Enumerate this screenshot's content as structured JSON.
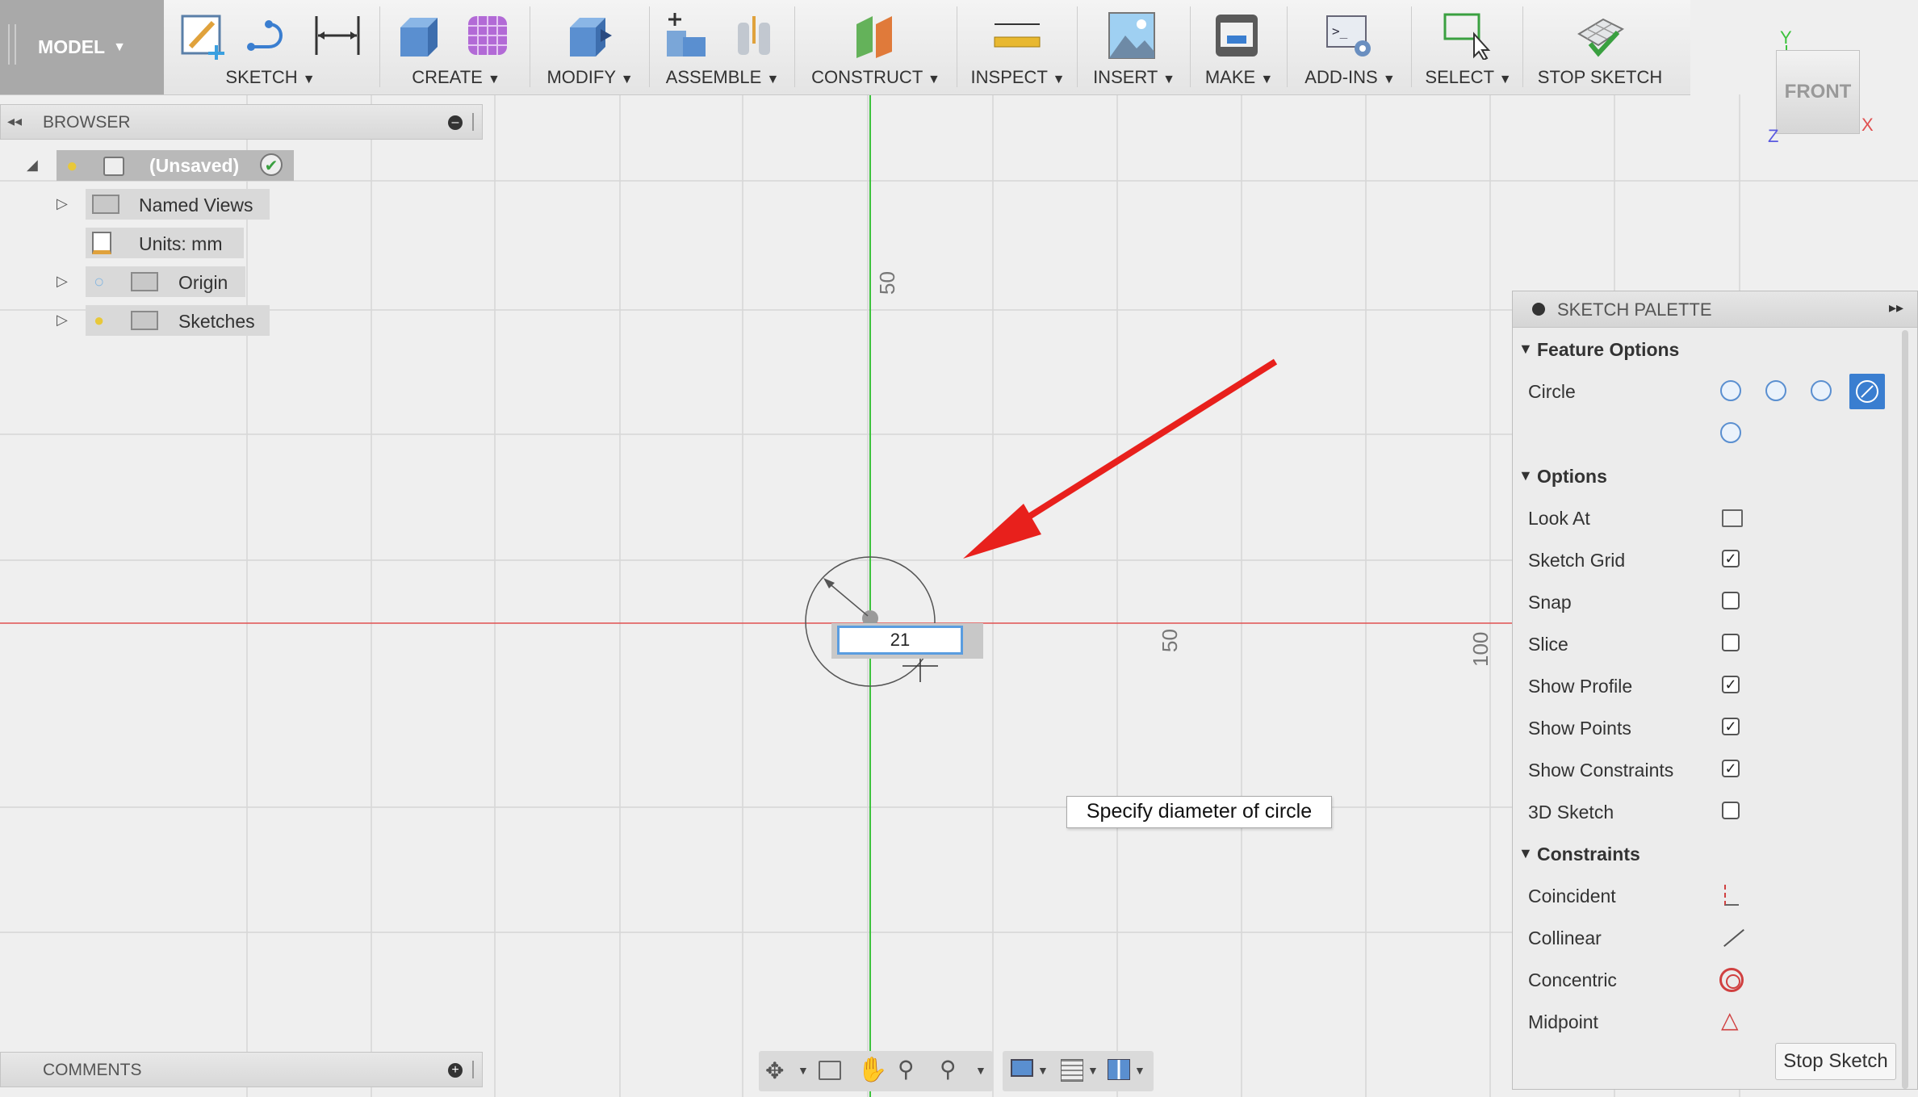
{
  "toolbar": {
    "model_label": "MODEL",
    "groups": [
      {
        "label": "SKETCH"
      },
      {
        "label": "CREATE"
      },
      {
        "label": "MODIFY"
      },
      {
        "label": "ASSEMBLE"
      },
      {
        "label": "CONSTRUCT"
      },
      {
        "label": "INSPECT"
      },
      {
        "label": "INSERT"
      },
      {
        "label": "MAKE"
      },
      {
        "label": "ADD-INS"
      },
      {
        "label": "SELECT"
      },
      {
        "label": "STOP SKETCH"
      }
    ]
  },
  "browser": {
    "title": "BROWSER",
    "root_label": "(Unsaved)",
    "items": [
      {
        "label": "Named Views"
      },
      {
        "label": "Units: mm"
      },
      {
        "label": "Origin"
      },
      {
        "label": "Sketches"
      }
    ]
  },
  "comments": {
    "title": "COMMENTS"
  },
  "canvas": {
    "ruler_labels": [
      "50",
      "50",
      "100"
    ],
    "dimension_value": "21",
    "tooltip": "Specify diameter of circle"
  },
  "viewcube": {
    "face": "FRONT",
    "axes": [
      "Y",
      "X",
      "Z"
    ]
  },
  "palette": {
    "title": "SKETCH PALETTE",
    "feature_options": {
      "title": "Feature Options",
      "circle_label": "Circle"
    },
    "options": {
      "title": "Options",
      "rows": [
        {
          "label": "Look At",
          "type": "button"
        },
        {
          "label": "Sketch Grid",
          "type": "checkbox",
          "checked": true
        },
        {
          "label": "Snap",
          "type": "checkbox",
          "checked": false
        },
        {
          "label": "Slice",
          "type": "checkbox",
          "checked": false
        },
        {
          "label": "Show Profile",
          "type": "checkbox",
          "checked": true
        },
        {
          "label": "Show Points",
          "type": "checkbox",
          "checked": true
        },
        {
          "label": "Show Constraints",
          "type": "checkbox",
          "checked": true
        },
        {
          "label": "3D Sketch",
          "type": "checkbox",
          "checked": false
        }
      ]
    },
    "constraints": {
      "title": "Constraints",
      "rows": [
        {
          "label": "Coincident"
        },
        {
          "label": "Collinear"
        },
        {
          "label": "Concentric"
        },
        {
          "label": "Midpoint"
        }
      ]
    },
    "stop_button": "Stop Sketch"
  },
  "colors": {
    "x_axis": "#e05050",
    "y_axis": "#3cc23c",
    "annotation_arrow": "#e8201c",
    "accent": "#5a9de0"
  }
}
